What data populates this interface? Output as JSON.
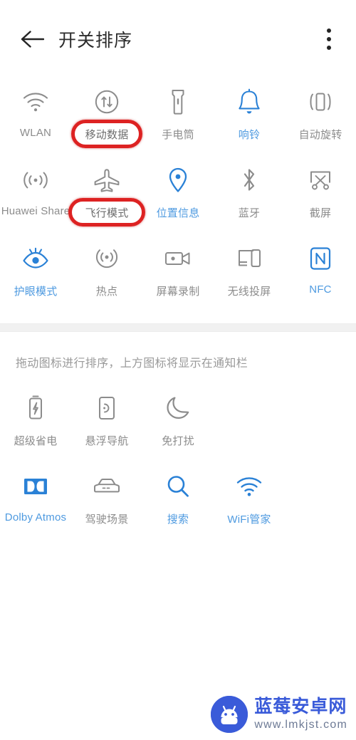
{
  "header": {
    "back_icon": "back-arrow-icon",
    "title": "开关排序",
    "more_icon": "more-vertical-icon"
  },
  "hint": "拖动图标进行排序，上方图标将显示在通知栏",
  "colors": {
    "accent_blue": "#2a81d6",
    "label_blue": "#4e9ae0",
    "label_gray": "#8c8c8c",
    "annotation_red": "#dd2222",
    "watermark_blue": "#3a5bd9"
  },
  "top_section": {
    "rows": [
      {
        "tiles": [
          {
            "label": "WLAN",
            "icon": "wifi-icon",
            "active": false,
            "annotated": false
          },
          {
            "label": "移动数据",
            "icon": "mobile-data-icon",
            "active": false,
            "annotated": true
          },
          {
            "label": "手电筒",
            "icon": "flashlight-icon",
            "active": false,
            "annotated": false
          },
          {
            "label": "响铃",
            "icon": "bell-icon",
            "active": true,
            "annotated": false
          },
          {
            "label": "自动旋转",
            "icon": "auto-rotate-icon",
            "active": false,
            "annotated": false
          }
        ]
      },
      {
        "tiles": [
          {
            "label": "Huawei Share",
            "icon": "huawei-share-icon",
            "active": false,
            "annotated": false
          },
          {
            "label": "飞行模式",
            "icon": "airplane-icon",
            "active": false,
            "annotated": true
          },
          {
            "label": "位置信息",
            "icon": "location-pin-icon",
            "active": true,
            "annotated": false
          },
          {
            "label": "蓝牙",
            "icon": "bluetooth-icon",
            "active": false,
            "annotated": false
          },
          {
            "label": "截屏",
            "icon": "screenshot-scissors-icon",
            "active": false,
            "annotated": false
          }
        ]
      },
      {
        "tiles": [
          {
            "label": "护眼模式",
            "icon": "eye-comfort-icon",
            "active": true,
            "annotated": false
          },
          {
            "label": "热点",
            "icon": "hotspot-icon",
            "active": false,
            "annotated": false
          },
          {
            "label": "屏幕录制",
            "icon": "screen-record-icon",
            "active": false,
            "annotated": false
          },
          {
            "label": "无线投屏",
            "icon": "wireless-cast-icon",
            "active": false,
            "annotated": false
          },
          {
            "label": "NFC",
            "icon": "nfc-icon",
            "active": true,
            "annotated": false
          }
        ]
      }
    ]
  },
  "bottom_section": {
    "rows": [
      {
        "tiles": [
          {
            "label": "超级省电",
            "icon": "battery-saver-icon",
            "active": false,
            "annotated": false
          },
          {
            "label": "悬浮导航",
            "icon": "floating-nav-icon",
            "active": false,
            "annotated": false
          },
          {
            "label": "免打扰",
            "icon": "do-not-disturb-moon-icon",
            "active": false,
            "annotated": false
          }
        ]
      },
      {
        "tiles": [
          {
            "label": "Dolby Atmos",
            "icon": "dolby-atmos-icon",
            "active": true,
            "annotated": false
          },
          {
            "label": "驾驶场景",
            "icon": "driving-mode-car-icon",
            "active": false,
            "annotated": false
          },
          {
            "label": "搜索",
            "icon": "search-icon",
            "active": true,
            "annotated": false
          },
          {
            "label": "WiFi管家",
            "icon": "wifi-manager-icon",
            "active": true,
            "annotated": false
          }
        ]
      }
    ]
  },
  "watermark": {
    "logo_icon": "android-robot-logo",
    "title": "蓝莓安卓网",
    "url": "www.lmkjst.com"
  }
}
